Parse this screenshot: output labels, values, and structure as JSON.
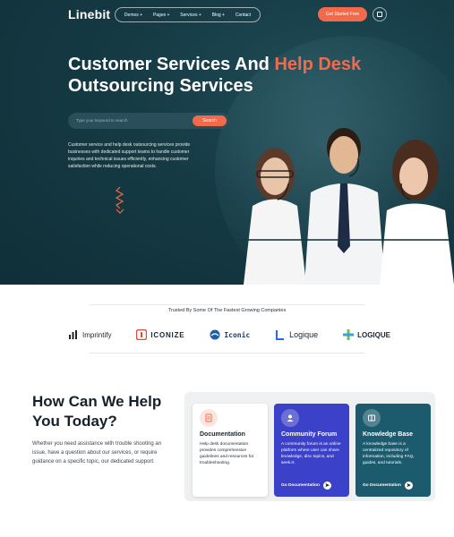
{
  "header": {
    "logo_text": "Linebit",
    "nav": [
      "Demos +",
      "Pages +",
      "Services +",
      "Blog +",
      "Contact"
    ],
    "cta_label": "Get Started Free",
    "grid_icon": "grid-icon"
  },
  "hero": {
    "title_line1_a": "Customer Services And ",
    "title_line1_accent": "Help Desk",
    "title_line2": "Outsourcing Services",
    "search_placeholder": "Type your keyword to search",
    "search_button": "Search",
    "description": "Customer service and help desk outsourcing services provide businesses with dedicated support teams to handle customer inquiries and technical issues efficiently, enhancing customer satisfaction while reducing operational costs."
  },
  "trusted": {
    "title": "Trusted By Some Of The Fastest Growing Companies",
    "brands": [
      "Imprintify",
      "ICONIZE",
      "Iconic",
      "Logique",
      "LOGIQUE"
    ]
  },
  "help": {
    "title_line1": "How Can We Help",
    "title_line2": "You Today?",
    "description": "Whether you need assistance with trouble shooting an issue, have a question about our services, or require guidance on a specific topic, our dedicated support.",
    "cards": [
      {
        "title": "Documentation",
        "text": "Help desk documentation provides comprehensive guidelines and resources for troubleshooting.",
        "link": ""
      },
      {
        "title": "Community Forum",
        "text": "A community forum is an online platform where user can share knowledge, disc topics, and seek.rt.",
        "link": "Go Documentation"
      },
      {
        "title": "Knowledge Base",
        "text": "A knowledge base is a centralized repository of information, including FAQ, guides, and tutorials.",
        "link": "Go Documentation"
      }
    ]
  },
  "colors": {
    "accent": "#f26a4b",
    "hero_bg": "#153a44",
    "forum": "#3b41c9",
    "knowledge": "#1c5a6e"
  }
}
